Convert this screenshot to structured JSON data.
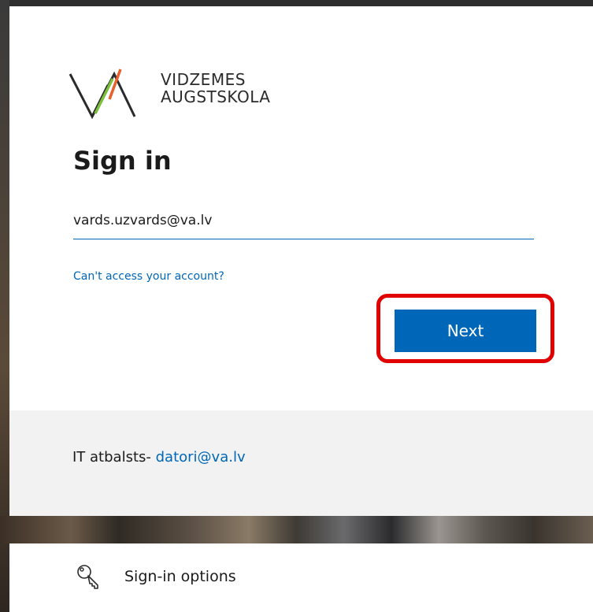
{
  "brand": {
    "line1": "VIDZEMES",
    "line2": "AUGSTSKOLA"
  },
  "signin": {
    "title": "Sign in",
    "email_value": "vards.uzvards@va.lv",
    "cant_access_link": "Can't access your account?",
    "next_button": "Next"
  },
  "support": {
    "prefix": "IT atbalsts-",
    "email_link": "datori@va.lv"
  },
  "options": {
    "label": "Sign-in options",
    "icon": "key-icon"
  },
  "colors": {
    "accent": "#0067b8",
    "highlight": "#e00000",
    "logo_green": "#7bbf3a",
    "logo_orange": "#e8602c"
  }
}
